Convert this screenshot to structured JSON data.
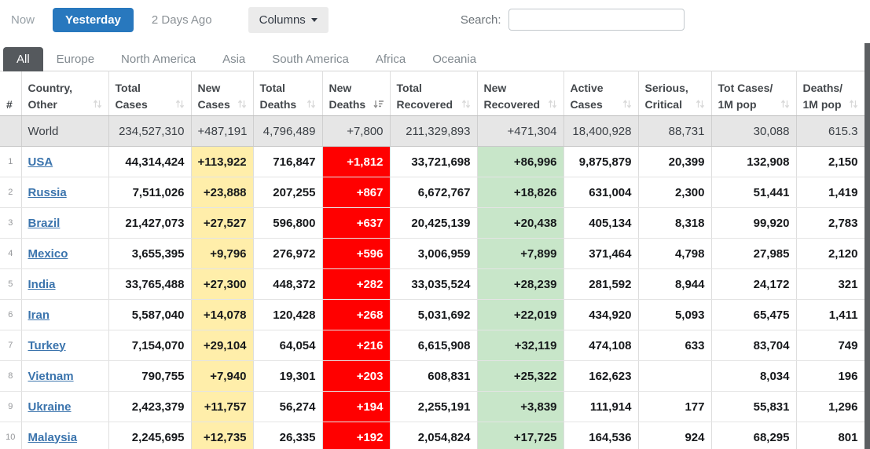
{
  "toolbar": {
    "now_label": "Now",
    "yesterday_label": "Yesterday",
    "two_days_ago_label": "2 Days Ago",
    "columns_label": "Columns",
    "search_label": "Search:",
    "search_value": "",
    "active_time_tab": "Yesterday"
  },
  "tabs": [
    "All",
    "Europe",
    "North America",
    "Asia",
    "South America",
    "Africa",
    "Oceania"
  ],
  "active_tab": "All",
  "colors": {
    "accent_blue": "#2878BE",
    "link_blue": "#3B74AD",
    "new_cases_bg": "#FFEEAA",
    "new_deaths_bg": "#FF0000",
    "new_recovered_bg": "#C8E6C9",
    "world_row_bg": "#E6E6E6",
    "active_tab_bg": "#55595D",
    "scrollbar_color": "#5C5F62"
  },
  "table": {
    "headers": [
      {
        "line1": "",
        "line2": "#",
        "sort": "none"
      },
      {
        "line1": "Country,",
        "line2": "Other",
        "sort": "both"
      },
      {
        "line1": "Total",
        "line2": "Cases",
        "sort": "both"
      },
      {
        "line1": "New",
        "line2": "Cases",
        "sort": "both"
      },
      {
        "line1": "Total",
        "line2": "Deaths",
        "sort": "both"
      },
      {
        "line1": "New",
        "line2": "Deaths",
        "sort": "desc"
      },
      {
        "line1": "Total",
        "line2": "Recovered",
        "sort": "both"
      },
      {
        "line1": "New",
        "line2": "Recovered",
        "sort": "both"
      },
      {
        "line1": "Active",
        "line2": "Cases",
        "sort": "both"
      },
      {
        "line1": "Serious,",
        "line2": "Critical",
        "sort": "both"
      },
      {
        "line1": "Tot Cases/",
        "line2": "1M pop",
        "sort": "both"
      },
      {
        "line1": "Deaths/",
        "line2": "1M pop",
        "sort": "both"
      }
    ],
    "world_row": {
      "rank": "",
      "country": "World",
      "cells": [
        "234,527,310",
        "+487,191",
        "4,796,489",
        "+7,800",
        "211,329,893",
        "+471,304",
        "18,400,928",
        "88,731",
        "30,088",
        "615.3"
      ]
    },
    "rows": [
      {
        "rank": "1",
        "country": "USA",
        "cells": [
          "44,314,424",
          "+113,922",
          "716,847",
          "+1,812",
          "33,721,698",
          "+86,996",
          "9,875,879",
          "20,399",
          "132,908",
          "2,150"
        ]
      },
      {
        "rank": "2",
        "country": "Russia",
        "cells": [
          "7,511,026",
          "+23,888",
          "207,255",
          "+867",
          "6,672,767",
          "+18,826",
          "631,004",
          "2,300",
          "51,441",
          "1,419"
        ]
      },
      {
        "rank": "3",
        "country": "Brazil",
        "cells": [
          "21,427,073",
          "+27,527",
          "596,800",
          "+637",
          "20,425,139",
          "+20,438",
          "405,134",
          "8,318",
          "99,920",
          "2,783"
        ]
      },
      {
        "rank": "4",
        "country": "Mexico",
        "cells": [
          "3,655,395",
          "+9,796",
          "276,972",
          "+596",
          "3,006,959",
          "+7,899",
          "371,464",
          "4,798",
          "27,985",
          "2,120"
        ]
      },
      {
        "rank": "5",
        "country": "India",
        "cells": [
          "33,765,488",
          "+27,300",
          "448,372",
          "+282",
          "33,035,524",
          "+28,239",
          "281,592",
          "8,944",
          "24,172",
          "321"
        ]
      },
      {
        "rank": "6",
        "country": "Iran",
        "cells": [
          "5,587,040",
          "+14,078",
          "120,428",
          "+268",
          "5,031,692",
          "+22,019",
          "434,920",
          "5,093",
          "65,475",
          "1,411"
        ]
      },
      {
        "rank": "7",
        "country": "Turkey",
        "cells": [
          "7,154,070",
          "+29,104",
          "64,054",
          "+216",
          "6,615,908",
          "+32,119",
          "474,108",
          "633",
          "83,704",
          "749"
        ]
      },
      {
        "rank": "8",
        "country": "Vietnam",
        "cells": [
          "790,755",
          "+7,940",
          "19,301",
          "+203",
          "608,831",
          "+25,322",
          "162,623",
          "",
          "8,034",
          "196"
        ]
      },
      {
        "rank": "9",
        "country": "Ukraine",
        "cells": [
          "2,423,379",
          "+11,757",
          "56,274",
          "+194",
          "2,255,191",
          "+3,839",
          "111,914",
          "177",
          "55,831",
          "1,296"
        ]
      },
      {
        "rank": "10",
        "country": "Malaysia",
        "cells": [
          "2,245,695",
          "+12,735",
          "26,335",
          "+192",
          "2,054,824",
          "+17,725",
          "164,536",
          "924",
          "68,295",
          "801"
        ]
      }
    ]
  }
}
